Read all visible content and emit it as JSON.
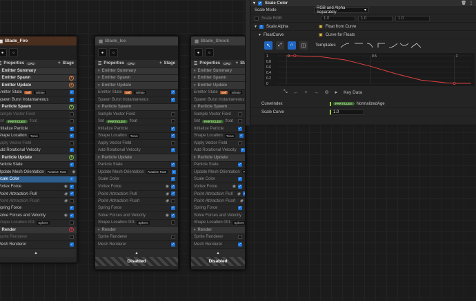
{
  "panels": [
    {
      "id": "fire",
      "title": "Blade_Fire",
      "disabled": false,
      "properties_label": "Properties",
      "properties_badge": "CPU",
      "stage_label": "Stage",
      "rows": [
        {
          "text": "Emitter Summary",
          "kind": "sec"
        },
        {
          "text": "Emitter Spawn",
          "kind": "sec",
          "add": "o"
        },
        {
          "text": "Emitter Update",
          "kind": "sec",
          "add": "o"
        },
        {
          "text": "Emitter State",
          "tag": "Self",
          "tag2": "Infinite",
          "check": true
        },
        {
          "text": "Spawn Burst Instantaneous",
          "check": true
        },
        {
          "text": "Particle Spawn",
          "kind": "sec",
          "add": "g"
        },
        {
          "text": "Sample Vector Field",
          "kind": "gray",
          "check": false
        },
        {
          "text": "Set",
          "pill": "PARTICLES",
          "after": "float",
          "kind": "gray",
          "check": false
        },
        {
          "text": "Initialize Particle",
          "check": true
        },
        {
          "text": "Shape Location",
          "tag": "Torus",
          "check": true
        },
        {
          "text": "Apply Vector Field",
          "kind": "gray",
          "check": false
        },
        {
          "text": "Add Rotational Velocity",
          "check": true
        },
        {
          "text": "Particle Update",
          "kind": "sec",
          "add": "g"
        },
        {
          "text": "Particle State",
          "check": true
        },
        {
          "text": "Update Mesh Orientation",
          "tag": "Rotation Rate",
          "eye": true,
          "check": true
        },
        {
          "text": "Scale Color",
          "kind": "sel",
          "check": true
        },
        {
          "text": "Vortex Force",
          "eye": true,
          "check": true
        },
        {
          "text": "Point Attraction Pull",
          "kind": "italic",
          "eye": true,
          "check": true
        },
        {
          "text": "Point Attraction Push",
          "kind": "italic gray",
          "eye": true,
          "check": false
        },
        {
          "text": "Spring Force",
          "check": true
        },
        {
          "text": "Solve Forces and Velocity",
          "eye": true,
          "check": true
        },
        {
          "text": "Shape Location 001",
          "tag": "Sphere",
          "kind": "gray",
          "check": false
        },
        {
          "text": "Render",
          "kind": "sec",
          "add": "r"
        },
        {
          "text": "Sprite Renderer",
          "kind": "gray",
          "check": false
        },
        {
          "text": "Mesh Renderer",
          "check": true
        }
      ]
    },
    {
      "id": "ice",
      "title": "Blade_Ice",
      "disabled": true,
      "disabled_label": "Disabled",
      "properties_label": "Properties",
      "properties_badge": "CPU",
      "stage_label": "Stage",
      "rows": [
        {
          "text": "Emitter Summary",
          "kind": "sec"
        },
        {
          "text": "Emitter Spawn",
          "kind": "sec"
        },
        {
          "text": "Emitter Update",
          "kind": "sec"
        },
        {
          "text": "Emitter State",
          "tag": "Self",
          "tag2": "Infinite",
          "check": true
        },
        {
          "text": "Spawn Burst Instantaneous",
          "check": true
        },
        {
          "text": "Particle Spawn",
          "kind": "sec"
        },
        {
          "text": "Sample Vector Field",
          "check": false
        },
        {
          "text": "Set",
          "pill": "PARTICLES",
          "after": "float",
          "check": false
        },
        {
          "text": "Initialize Particle",
          "check": true
        },
        {
          "text": "Shape Location",
          "tag": "Torus",
          "check": true
        },
        {
          "text": "Apply Vector Field",
          "check": false
        },
        {
          "text": "Add Rotational Velocity",
          "check": true
        },
        {
          "text": "Particle Update",
          "kind": "sec"
        },
        {
          "text": "Particle State",
          "check": true
        },
        {
          "text": "Update Mesh Orientation",
          "tag": "Rotation Rate",
          "check": true
        },
        {
          "text": "Scale Color",
          "check": true
        },
        {
          "text": "Vortex Force",
          "eye": true,
          "check": true
        },
        {
          "text": "Point Attraction Pull",
          "kind": "italic",
          "eye": true,
          "check": true
        },
        {
          "text": "Point Attraction Push",
          "kind": "italic",
          "eye": true,
          "check": false
        },
        {
          "text": "Spring Force",
          "check": true
        },
        {
          "text": "Solve Forces and Velocity",
          "eye": true,
          "check": true
        },
        {
          "text": "Shape Location 001",
          "tag": "Sphere",
          "check": false
        },
        {
          "text": "Render",
          "kind": "sec"
        },
        {
          "text": "Sprite Renderer",
          "check": false
        },
        {
          "text": "Mesh Renderer",
          "check": true
        }
      ]
    },
    {
      "id": "shock",
      "title": "Blade_Shock",
      "disabled": true,
      "disabled_label": "Disabled",
      "properties_label": "Properties",
      "properties_badge": "CPU",
      "stage_label": "Stage",
      "rows": [
        {
          "text": "Emitter Summary",
          "kind": "sec"
        },
        {
          "text": "Emitter Spawn",
          "kind": "sec"
        },
        {
          "text": "Emitter Update",
          "kind": "sec"
        },
        {
          "text": "Emitter State",
          "tag": "Self",
          "tag2": "Infinite",
          "check": true
        },
        {
          "text": "Spawn Burst Instantaneous",
          "check": true
        },
        {
          "text": "Particle Spawn",
          "kind": "sec"
        },
        {
          "text": "Sample Vector Field",
          "check": false
        },
        {
          "text": "Set",
          "pill": "PARTICLES",
          "after": "float",
          "check": false
        },
        {
          "text": "Initialize Particle",
          "check": true
        },
        {
          "text": "Shape Location",
          "tag": "Torus",
          "check": true
        },
        {
          "text": "Apply Vector Field",
          "check": false
        },
        {
          "text": "Add Rotational Velocity",
          "check": true
        },
        {
          "text": "Particle Update",
          "kind": "sec"
        },
        {
          "text": "Particle State",
          "check": true
        },
        {
          "text": "Update Mesh Orientation",
          "tag": "Rotation Rate",
          "check": true
        },
        {
          "text": "Scale Color",
          "check": true
        },
        {
          "text": "Vortex Force",
          "eye": true,
          "check": true
        },
        {
          "text": "Point Attraction Pull",
          "kind": "italic",
          "eye": true,
          "check": true
        },
        {
          "text": "Point Attraction Push",
          "kind": "italic",
          "eye": true,
          "check": false
        },
        {
          "text": "Spring Force",
          "check": true
        },
        {
          "text": "Solve Forces and Velocity",
          "eye": true,
          "check": true
        },
        {
          "text": "Shape Location 001",
          "tag": "Sphere",
          "check": false
        },
        {
          "text": "Render",
          "kind": "sec"
        },
        {
          "text": "Sprite Renderer",
          "check": false
        },
        {
          "text": "Mesh Renderer",
          "check": true
        }
      ]
    }
  ],
  "details": {
    "section_title": "Scale Color",
    "scale_mode_label": "Scale Mode",
    "scale_mode_value": "RGB and Alpha Separately",
    "scale_rgb_label": "Scale RGB",
    "scale_rgb_values": [
      "1.0",
      "1.0",
      "1.0"
    ],
    "scale_alpha_label": "Scale Alpha",
    "scale_alpha_value": "Float from Curve",
    "floatcurve_label": "FloatCurve",
    "floatcurve_value": "Curve for Floats",
    "templates_label": "Templates",
    "y_ticks": [
      "1",
      "0.8",
      "0.6",
      "0.4",
      "0.2",
      "0"
    ],
    "x_ticks": [
      "0",
      "0.5",
      "1"
    ],
    "key_data_label": "Key Data",
    "curveindex_label": "CurveIndex",
    "curveindex_pill": "PARTICLES",
    "curveindex_value": "NormalizedAge",
    "scale_curve_label": "Scale Curve",
    "scale_curve_value": "1.0"
  },
  "chart_data": {
    "type": "line",
    "x": [
      0,
      0.05,
      0.2,
      0.35,
      0.5,
      0.65,
      0.8,
      0.95,
      1.0,
      1.1
    ],
    "y": [
      1,
      1,
      0.97,
      0.85,
      0.62,
      0.35,
      0.12,
      0.02,
      0,
      0
    ],
    "xlim": [
      -0.05,
      1.1
    ],
    "ylim": [
      0,
      1
    ],
    "keys": [
      [
        0.05,
        1
      ],
      [
        1.0,
        0
      ]
    ],
    "color": "#e04040"
  },
  "colors": {
    "accent_blue": "#2167c4",
    "selected_row": "#2f5f8f",
    "panel_header": "#4a2e1e",
    "green_pill": "#3a6b2b",
    "curve": "#e04040"
  }
}
